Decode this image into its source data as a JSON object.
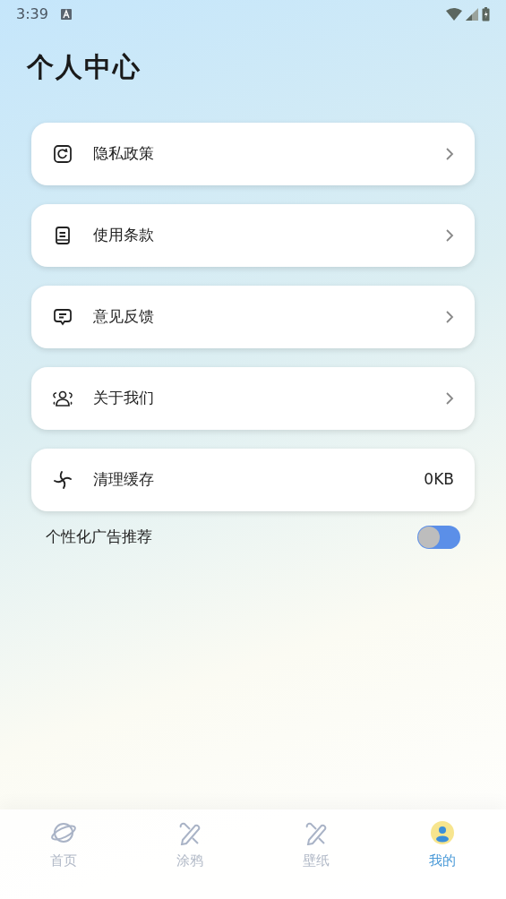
{
  "status_bar": {
    "time": "3:39"
  },
  "title": "个人中心",
  "menu": [
    {
      "label": "隐私政策",
      "kind": "link"
    },
    {
      "label": "使用条款",
      "kind": "link"
    },
    {
      "label": "意见反馈",
      "kind": "link"
    },
    {
      "label": "关于我们",
      "kind": "link"
    },
    {
      "label": "清理缓存",
      "kind": "value",
      "value": "0KB"
    }
  ],
  "ad_setting": {
    "label": "个性化广告推荐",
    "on": false
  },
  "tabs": [
    {
      "label": "首页",
      "selected": false
    },
    {
      "label": "涂鸦",
      "selected": false
    },
    {
      "label": "壁纸",
      "selected": false
    },
    {
      "label": "我的",
      "selected": true
    }
  ]
}
